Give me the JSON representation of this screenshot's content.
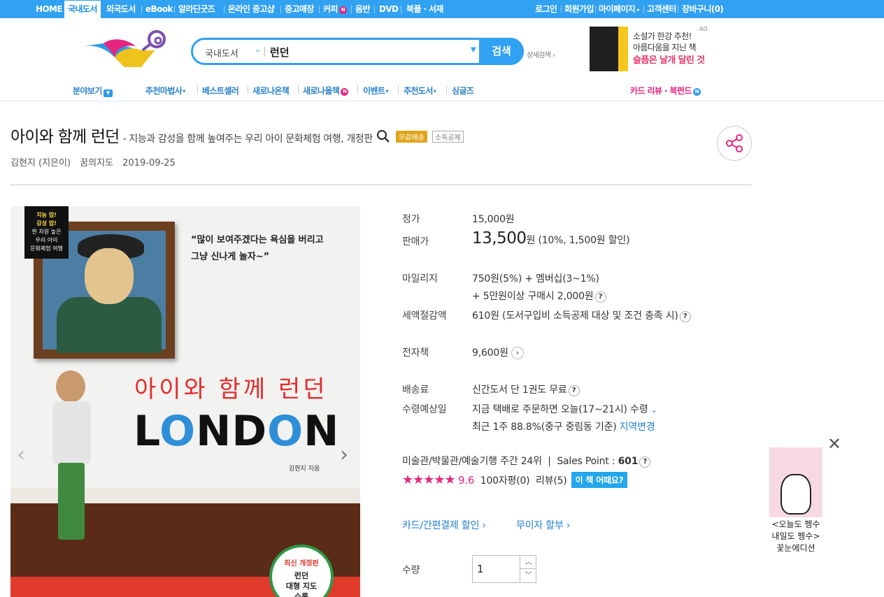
{
  "topnav": {
    "left": [
      "HOME",
      "국내도서",
      "외국도서",
      "eBook",
      "알라딘굿즈",
      "온라인 중고샵",
      "중고매장",
      "커피",
      "음반",
      "DVD",
      "북플 · 서재"
    ],
    "right": [
      "로그인",
      "회원가입",
      "마이페이지",
      "고객센터",
      "장바구니(0)"
    ]
  },
  "search": {
    "category": "국내도서",
    "query": "런던",
    "button": "검색",
    "advanced": "상세검색"
  },
  "ad": {
    "line1": "소설가 한강 추천!",
    "line2": "아름다움을 지닌 책",
    "line3": "슬픔은 날개 달린 것",
    "tag": "AD"
  },
  "gnb": [
    "분야보기",
    "추천마법사",
    "베스트셀러",
    "새로나온책",
    "새로나올책",
    "이벤트",
    "추천도서",
    "싱글즈"
  ],
  "gnb_right": "카드 리뷰 · 북펀드",
  "product": {
    "title": "아이와 함께 런던",
    "subtitle": "- 지능과 감성을 함께 높여주는 우리 아이 문화체험 여행, 개정판",
    "badge_free": "무료배송",
    "badge_tax": "소득공제",
    "author": "김현지 (지은이)",
    "publisher": "꿈의지도",
    "date": "2019-09-25"
  },
  "cover": {
    "tag1": "지능 업!",
    "tag2": "감성 업!",
    "tag3": "한 차원 높은",
    "tag4": "우리 아이",
    "tag5": "문화체험 여행",
    "quote1": "많이 보여주겠다는 욕심을 버리고",
    "quote2": "그냥 신나게 놀자~",
    "korean": "아이와 함께 런던",
    "english_1": "L",
    "english_2": "O",
    "english_3": "ND",
    "english_4": "O",
    "english_5": "N",
    "author": "김현지 지음",
    "seal1": "최신 개정판",
    "seal2": "런던",
    "seal3": "대형 지도",
    "seal4": "수록"
  },
  "info": {
    "list_price_label": "정가",
    "list_price": "15,000원",
    "sale_label": "판매가",
    "sale_price": "13,500",
    "sale_unit": "원",
    "sale_note": "(10%, 1,500원 할인)",
    "mileage_label": "마일리지",
    "mileage1": "750원(5%) + 멤버십(3~1%)",
    "mileage2": "+ 5만원이상 구매시 2,000원",
    "tax_label": "세액절감액",
    "tax": "610원 (도서구입비 소득공제 대상 및 조건 충족 시)",
    "ebook_label": "전자책",
    "ebook": "9,600원",
    "ship_label": "배송료",
    "ship": "신간도서 단 1권도 무료",
    "eta_label": "수령예상일",
    "eta": "지금 택배로 주문하면 오늘(17~21시) 수령",
    "eta2": "최근 1주 88.8%(중구 중림동 기준)",
    "eta_change": "지역변경",
    "rank": "미술관/박물관/예술기행 주간 24위",
    "sales_point_label": "Sales Point : ",
    "sales_point": "601",
    "stars": "★★★★★",
    "score": "9.6",
    "reviews_100": "100자평(0)",
    "reviews": "리뷰(5)",
    "how": "이 책 어때요?",
    "card": "카드/간편결제 할인",
    "installment": "무이자 할부",
    "qty_label": "수량",
    "qty": "1"
  },
  "float": {
    "caption1": "<오늘도 펭수",
    "caption2": "내일도 펭수>",
    "caption3": "꽃눈에디션"
  }
}
